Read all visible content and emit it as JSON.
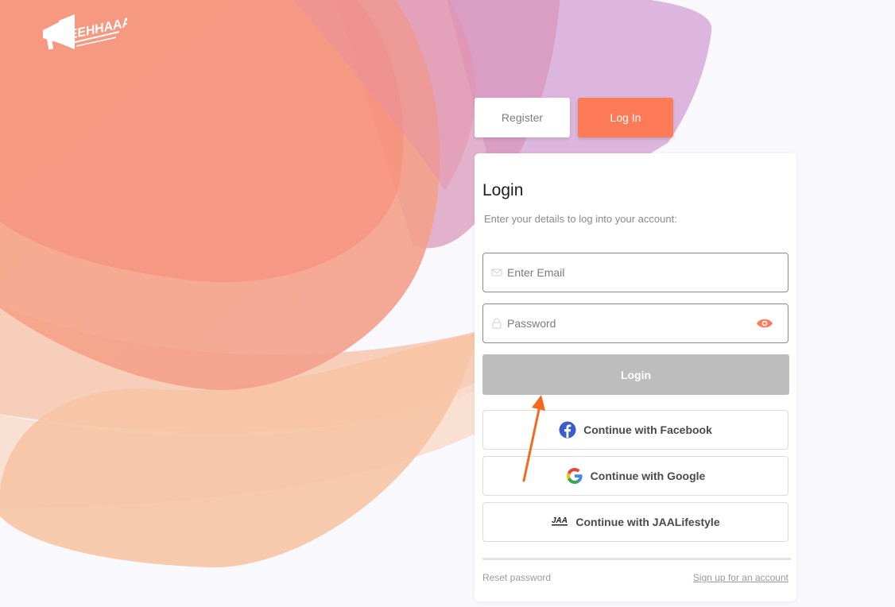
{
  "brand": {
    "logo_text": "EEHHAAA"
  },
  "tabs": {
    "register_label": "Register",
    "login_label": "Log In"
  },
  "login_card": {
    "title": "Login",
    "subtitle": "Enter your details to log into your account:",
    "email": {
      "placeholder": "Enter Email",
      "value": ""
    },
    "password": {
      "placeholder": "Password",
      "value": ""
    },
    "submit_label": "Login",
    "social": {
      "facebook_label": "Continue with Facebook",
      "google_label": "Continue with Google",
      "jaa_label": "Continue with JAALifestyle",
      "jaa_logo_text": "JAA"
    },
    "reset_link": "Reset password",
    "signup_link": "Sign up for an account"
  },
  "colors": {
    "accent": "#ff7b58",
    "disabled_button": "#bdbdbd",
    "annotation_arrow": "#f26a1b"
  },
  "icons": [
    "megaphone-icon",
    "mail-icon",
    "lock-icon",
    "eye-icon",
    "facebook-icon",
    "google-icon",
    "jaa-logo-icon",
    "arrow-annotation"
  ]
}
